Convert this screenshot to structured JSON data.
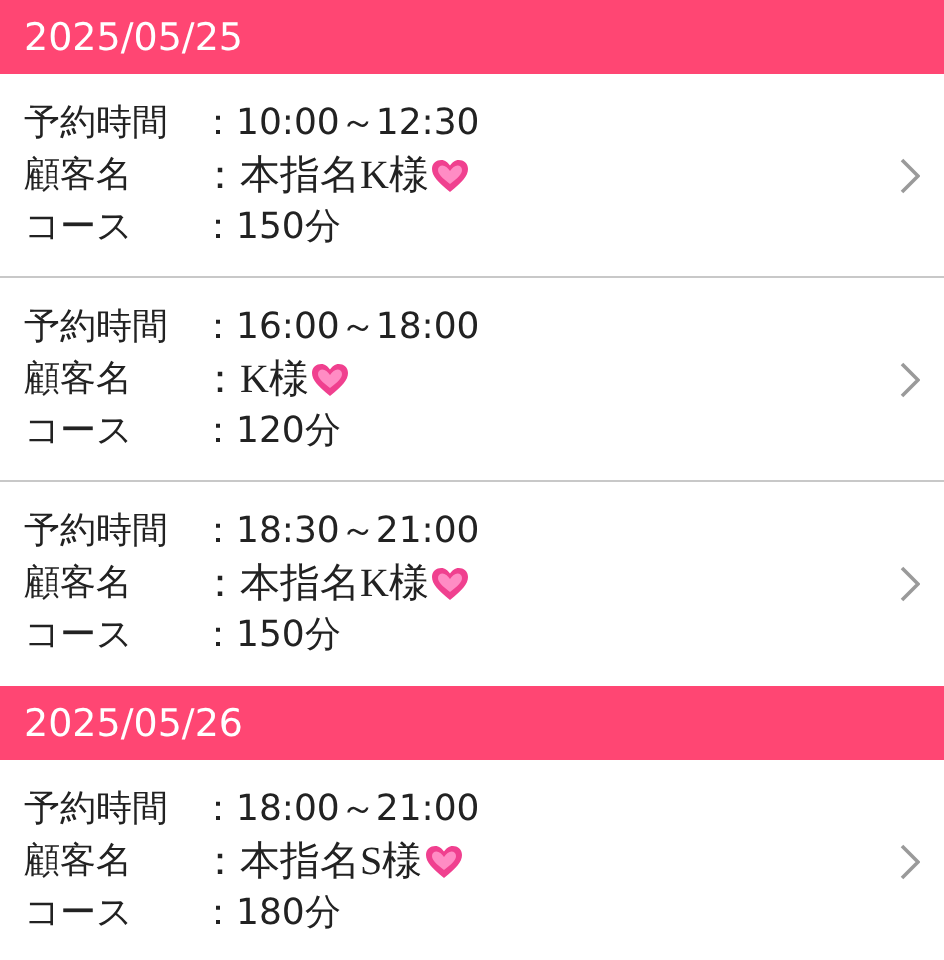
{
  "days": [
    {
      "date": "2025/05/25",
      "reservations": [
        {
          "time_label": "予約時間",
          "time": "：10:00～12:30",
          "customer_label": "顧客名",
          "customer": "：本指名K様",
          "course_label": "コース",
          "course": "：150分"
        },
        {
          "time_label": "予約時間",
          "time": "：16:00～18:00",
          "customer_label": "顧客名",
          "customer": "：K様",
          "course_label": "コース",
          "course": "：120分"
        },
        {
          "time_label": "予約時間",
          "time": "：18:30～21:00",
          "customer_label": "顧客名",
          "customer": "：本指名K様",
          "course_label": "コース",
          "course": "：150分"
        }
      ]
    },
    {
      "date": "2025/05/26",
      "reservations": [
        {
          "time_label": "予約時間",
          "time": "：18:00～21:00",
          "customer_label": "顧客名",
          "customer": "：本指名S様",
          "course_label": "コース",
          "course": "：180分"
        }
      ]
    }
  ]
}
